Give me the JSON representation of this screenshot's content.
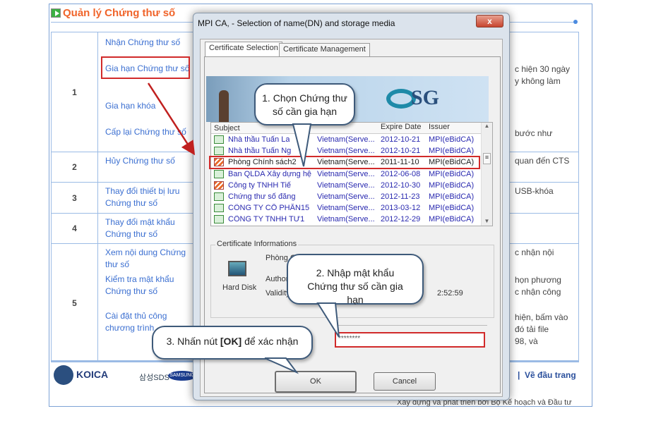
{
  "page": {
    "title": "Quản lý Chứng thư số",
    "rows": [
      {
        "num": "1",
        "links": [
          "Nhận Chứng thư số",
          "Gia hạn Chứng thư số",
          "Gia hạn khóa",
          "Cấp lại Chứng thư số"
        ],
        "right": [
          "c hiện 30 ngày",
          "y không làm",
          "bước như"
        ]
      },
      {
        "num": "2",
        "links": [
          "Hủy Chứng thư số"
        ],
        "right": [
          "quan đến CTS"
        ]
      },
      {
        "num": "3",
        "links": [
          "Thay đổi thiết bị lưu Chứng thư số"
        ],
        "right": [
          "USB-khóa"
        ]
      },
      {
        "num": "4",
        "links": [
          "Thay đổi mật khẩu Chứng thư số"
        ],
        "right": []
      },
      {
        "num": "5",
        "links": [
          "Xem nội dung Chứng thư số",
          "Kiểm tra mật khẩu Chứng thư số",
          "Cài đặt thủ công chương trình"
        ],
        "right": [
          "c nhận nội",
          "họn phương",
          "c nhận công",
          "hiện, bấm vào",
          "đó tải file",
          "98, và"
        ]
      }
    ],
    "footer": {
      "logos": [
        "KOICA",
        "삼성SDS",
        "SAMSUNG"
      ],
      "top_link": "Về đầu trang",
      "separator": "|",
      "credit": "Xây dựng và phát triển bởi Bộ Kế hoạch và Đầu tư"
    }
  },
  "dialog": {
    "title": "MPI CA, - Selection of name(DN) and storage media",
    "close": "x",
    "tabs": [
      "Certificate Selection",
      "Certificate Management"
    ],
    "banner_logo": "SG",
    "columns": [
      "Subject",
      "",
      "Expire Date",
      "Issuer"
    ],
    "certs": [
      {
        "subject": "Nhà thầu Tuấn La",
        "dn": "Vietnam(Serve...",
        "expire": "2012-10-21",
        "issuer": "MPI(eBidCA)",
        "expired": false
      },
      {
        "subject": "Nhà thầu Tuấn Ng",
        "dn": "Vietnam(Serve...",
        "expire": "2012-10-21",
        "issuer": "MPI(eBidCA)",
        "expired": false
      },
      {
        "subject": "Phòng Chính sách2",
        "dn": "Vietnam(Serve...",
        "expire": "2011-11-10",
        "issuer": "MPI(eBidCA)",
        "expired": true,
        "selected": true
      },
      {
        "subject": "Ban QLDA Xây dựng hệ",
        "dn": "Vietnam(Serve...",
        "expire": "2012-06-08",
        "issuer": "MPI(eBidCA)",
        "expired": false
      },
      {
        "subject": "Công ty TNHH Tiế",
        "dn": "Vietnam(Serve...",
        "expire": "2012-10-30",
        "issuer": "MPI(eBidCA)",
        "expired": true
      },
      {
        "subject": "Chứng thư số đăng",
        "dn": "Vietnam(Serve...",
        "expire": "2012-11-23",
        "issuer": "MPI(eBidCA)",
        "expired": false
      },
      {
        "subject": "CÔNG TY CỔ PHẦN15",
        "dn": "Vietnam(Serve...",
        "expire": "2013-03-12",
        "issuer": "MPI(eBidCA)",
        "expired": false
      },
      {
        "subject": "CÔNG TY TNHH TƯ1",
        "dn": "Vietnam(Serve...",
        "expire": "2012-12-29",
        "issuer": "MPI(eBidCA)",
        "expired": false
      }
    ],
    "info": {
      "group_label": "Certificate Informations",
      "media": "Hard Disk",
      "name_partial": "Phòng C",
      "authority_label": "Authori",
      "validity_label": "Validity :",
      "validity_partial": "2:52:59"
    },
    "password": "********",
    "ok": "OK",
    "cancel": "Cancel"
  },
  "callouts": {
    "step1": "1. Chọn Chứng thư số cần gia hạn",
    "step2": "2. Nhập mật khẩu Chứng thư số cần gia hạn",
    "step3_pre": "3. Nhấn nút ",
    "step3_bold": "[OK]",
    "step3_post": " để xác nhận"
  },
  "colors": {
    "title": "#f0642a",
    "link": "#3b6fd1",
    "highlight": "#d12a2a"
  }
}
